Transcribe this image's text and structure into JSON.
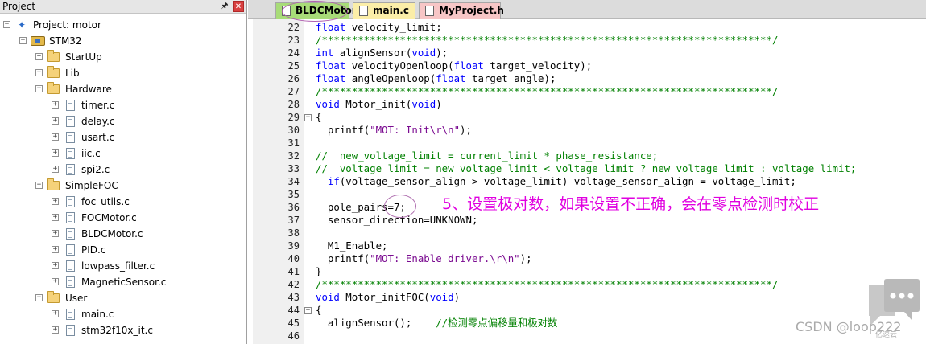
{
  "panel": {
    "title": "Project",
    "pin_icon": "pin-icon",
    "close_icon": "close-icon"
  },
  "tree": [
    {
      "label": "Project: motor",
      "kind": "project",
      "level": 0,
      "expanded": true
    },
    {
      "label": "STM32",
      "kind": "target",
      "level": 1,
      "expanded": true
    },
    {
      "label": "StartUp",
      "kind": "folder",
      "level": 2,
      "expanded": false
    },
    {
      "label": "Lib",
      "kind": "folder",
      "level": 2,
      "expanded": false
    },
    {
      "label": "Hardware",
      "kind": "folder",
      "level": 2,
      "expanded": true
    },
    {
      "label": "timer.c",
      "kind": "file",
      "level": 3
    },
    {
      "label": "delay.c",
      "kind": "file",
      "level": 3
    },
    {
      "label": "usart.c",
      "kind": "file",
      "level": 3
    },
    {
      "label": "iic.c",
      "kind": "file",
      "level": 3
    },
    {
      "label": "spi2.c",
      "kind": "file",
      "level": 3
    },
    {
      "label": "SimpleFOC",
      "kind": "folder",
      "level": 2,
      "expanded": true
    },
    {
      "label": "foc_utils.c",
      "kind": "file",
      "level": 3
    },
    {
      "label": "FOCMotor.c",
      "kind": "file",
      "level": 3
    },
    {
      "label": "BLDCMotor.c",
      "kind": "file",
      "level": 3
    },
    {
      "label": "PID.c",
      "kind": "file",
      "level": 3
    },
    {
      "label": "lowpass_filter.c",
      "kind": "file",
      "level": 3
    },
    {
      "label": "MagneticSensor.c",
      "kind": "file",
      "level": 3
    },
    {
      "label": "User",
      "kind": "folder",
      "level": 2,
      "expanded": true
    },
    {
      "label": "main.c",
      "kind": "file",
      "level": 3
    },
    {
      "label": "stm32f10x_it.c",
      "kind": "file",
      "level": 3
    }
  ],
  "tabs": [
    {
      "label": "BLDCMotor.c",
      "active": true,
      "color": "#a8dc78"
    },
    {
      "label": "main.c",
      "active": false,
      "color": "#fbeea8"
    },
    {
      "label": "MyProject.h",
      "active": false,
      "color": "#f7c6c6"
    }
  ],
  "code_lines": [
    {
      "n": "22",
      "fold": "",
      "parts": [
        [
          "k",
          "float"
        ],
        [
          "t",
          " velocity_limit;"
        ]
      ]
    },
    {
      "n": "23",
      "fold": "",
      "parts": [
        [
          "c",
          "/***************************************************************************/"
        ]
      ]
    },
    {
      "n": "24",
      "fold": "",
      "parts": [
        [
          "k",
          "int"
        ],
        [
          "t",
          " alignSensor("
        ],
        [
          "k",
          "void"
        ],
        [
          "t",
          ");"
        ]
      ]
    },
    {
      "n": "25",
      "fold": "",
      "parts": [
        [
          "k",
          "float"
        ],
        [
          "t",
          " velocityOpenloop("
        ],
        [
          "k",
          "float"
        ],
        [
          "t",
          " target_velocity);"
        ]
      ]
    },
    {
      "n": "26",
      "fold": "",
      "parts": [
        [
          "k",
          "float"
        ],
        [
          "t",
          " angleOpenloop("
        ],
        [
          "k",
          "float"
        ],
        [
          "t",
          " target_angle);"
        ]
      ]
    },
    {
      "n": "27",
      "fold": "",
      "parts": [
        [
          "c",
          "/***************************************************************************/"
        ]
      ]
    },
    {
      "n": "28",
      "fold": "",
      "parts": [
        [
          "k",
          "void"
        ],
        [
          "t",
          " Motor_init("
        ],
        [
          "k",
          "void"
        ],
        [
          "t",
          ")"
        ]
      ]
    },
    {
      "n": "29",
      "fold": "open",
      "parts": [
        [
          "t",
          "{"
        ]
      ]
    },
    {
      "n": "30",
      "fold": "line",
      "parts": [
        [
          "t",
          "  printf("
        ],
        [
          "s",
          "\"MOT: Init\\r\\n\""
        ],
        [
          "t",
          ");"
        ]
      ]
    },
    {
      "n": "31",
      "fold": "line",
      "parts": []
    },
    {
      "n": "32",
      "fold": "line",
      "parts": [
        [
          "c",
          "//  new_voltage_limit = current_limit * phase_resistance;"
        ]
      ]
    },
    {
      "n": "33",
      "fold": "line",
      "parts": [
        [
          "c",
          "//  voltage_limit = new_voltage_limit < voltage_limit ? new_voltage_limit : voltage_limit;"
        ]
      ]
    },
    {
      "n": "34",
      "fold": "line",
      "parts": [
        [
          "t",
          "  "
        ],
        [
          "k",
          "if"
        ],
        [
          "t",
          "(voltage_sensor_align > voltage_limit) voltage_sensor_align = voltage_limit;"
        ]
      ]
    },
    {
      "n": "35",
      "fold": "line",
      "parts": []
    },
    {
      "n": "36",
      "fold": "line",
      "parts": [
        [
          "t",
          "  pole_pairs=7;"
        ]
      ]
    },
    {
      "n": "37",
      "fold": "line",
      "parts": [
        [
          "t",
          "  sensor_direction=UNKNOWN;"
        ]
      ]
    },
    {
      "n": "38",
      "fold": "line",
      "parts": []
    },
    {
      "n": "39",
      "fold": "line",
      "parts": [
        [
          "t",
          "  M1_Enable;"
        ]
      ]
    },
    {
      "n": "40",
      "fold": "line",
      "parts": [
        [
          "t",
          "  printf("
        ],
        [
          "s",
          "\"MOT: Enable driver.\\r\\n\""
        ],
        [
          "t",
          ");"
        ]
      ]
    },
    {
      "n": "41",
      "fold": "end",
      "parts": [
        [
          "t",
          "}"
        ]
      ]
    },
    {
      "n": "42",
      "fold": "",
      "parts": [
        [
          "c",
          "/***************************************************************************/"
        ]
      ]
    },
    {
      "n": "43",
      "fold": "",
      "parts": [
        [
          "k",
          "void"
        ],
        [
          "t",
          " Motor_initFOC("
        ],
        [
          "k",
          "void"
        ],
        [
          "t",
          ")"
        ]
      ]
    },
    {
      "n": "44",
      "fold": "open",
      "parts": [
        [
          "t",
          "{"
        ]
      ]
    },
    {
      "n": "45",
      "fold": "line",
      "parts": [
        [
          "t",
          "  alignSensor();    "
        ],
        [
          "c",
          "//检测零点偏移量和极对数"
        ]
      ]
    },
    {
      "n": "46",
      "fold": "line",
      "parts": []
    }
  ],
  "annotation": "5、设置极对数，如果设置不正确，会在零点检测时校正",
  "watermark": {
    "text": "CSDN @loop222",
    "sub": "亿速云",
    "logo_icon": "chat-bubble-logo"
  },
  "colors": {
    "keyword": "#0000ff",
    "string": "#7a0a90",
    "comment": "#008000",
    "annotation": "#e000e0"
  }
}
